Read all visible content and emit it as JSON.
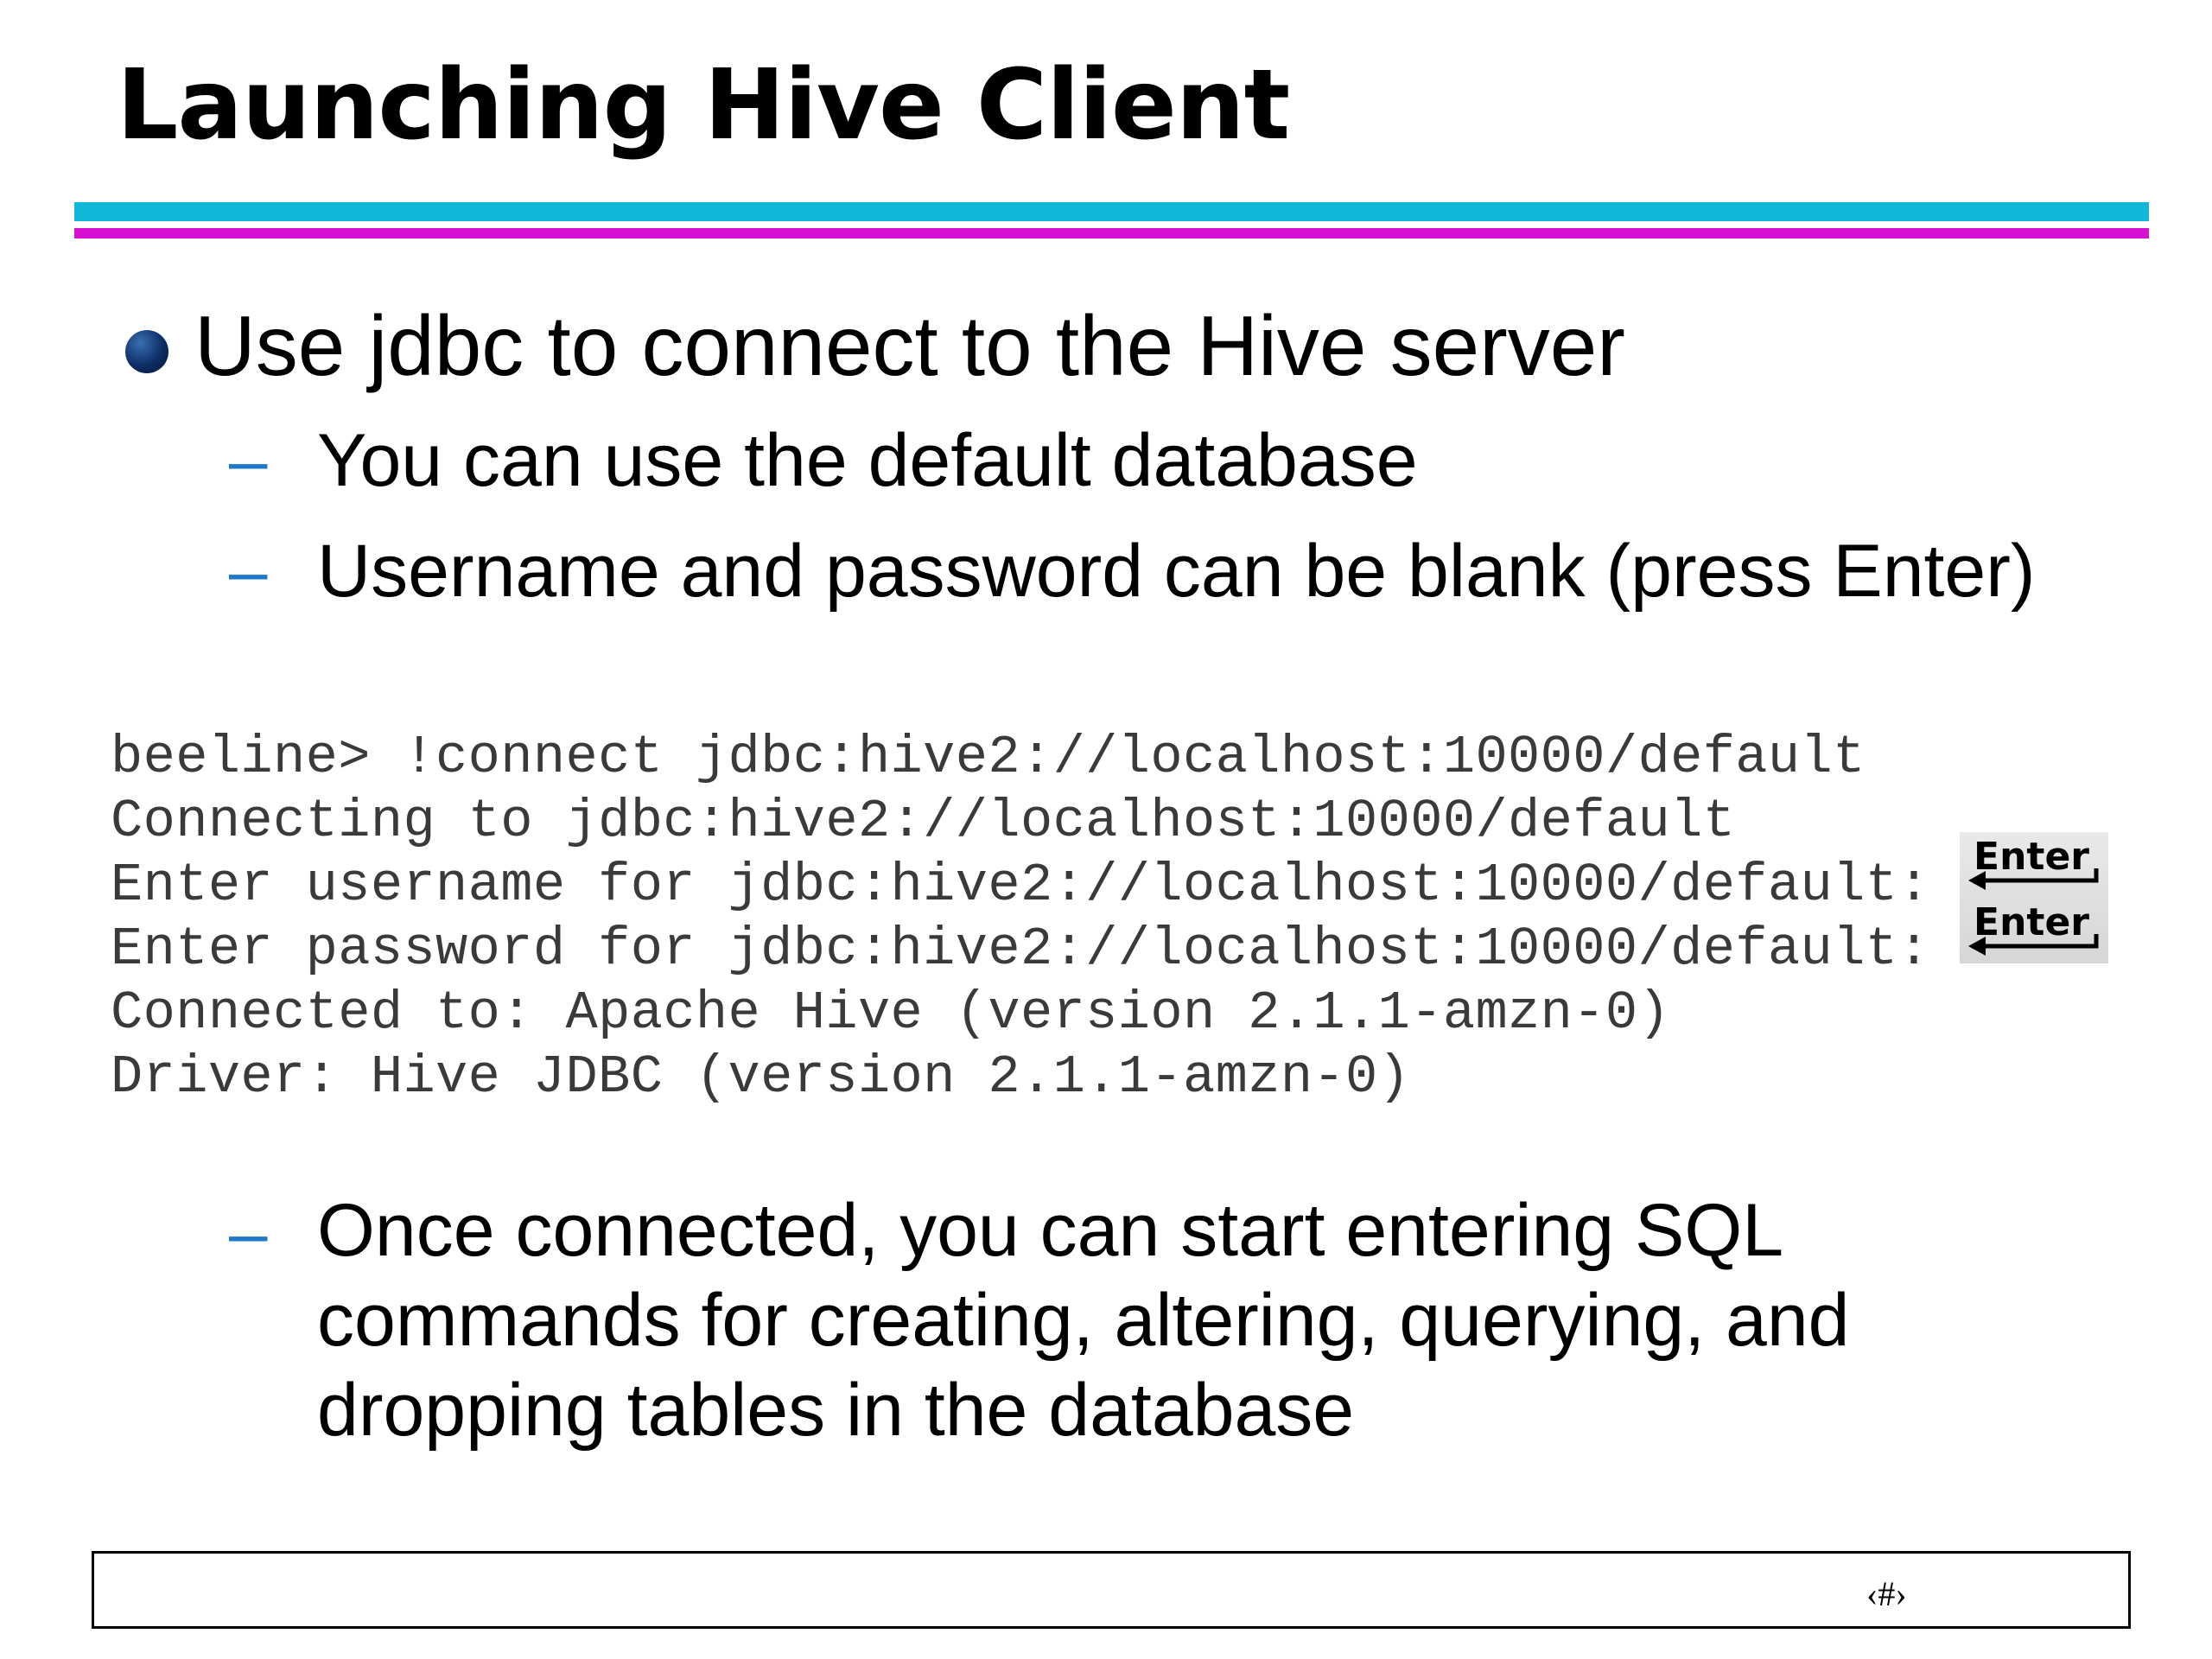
{
  "slide": {
    "title": "Launching Hive Client",
    "bullet": "Use jdbc to connect to the Hive server",
    "dash_symbol": "–",
    "sub_bullets": [
      "You can use the default database",
      "Username and password can be blank (press Enter)",
      "Once connected, you can start entering SQL commands for creating, altering, querying, and dropping tables in the database"
    ]
  },
  "terminal": {
    "lines": [
      "beeline> !connect jdbc:hive2://localhost:10000/default",
      "Connecting to jdbc:hive2://localhost:10000/default",
      "Enter username for jdbc:hive2://localhost:10000/default:",
      "Enter password for jdbc:hive2://localhost:10000/default:",
      "Connected to: Apache Hive (version 2.1.1-amzn-0)",
      "Driver: Hive JDBC (version 2.1.1-amzn-0)"
    ]
  },
  "enter_keys": [
    {
      "label": "Enter",
      "icon": "enter-arrow-icon"
    },
    {
      "label": "Enter",
      "icon": "enter-arrow-icon"
    }
  ],
  "footer": {
    "page_number": "‹#›"
  },
  "colors": {
    "rule_cyan": "#11b7d9",
    "rule_magenta": "#d60fd3",
    "bullet_dot": "#0d2d66",
    "dash": "#1e78c8",
    "terminal_text": "#3a3a3a"
  }
}
